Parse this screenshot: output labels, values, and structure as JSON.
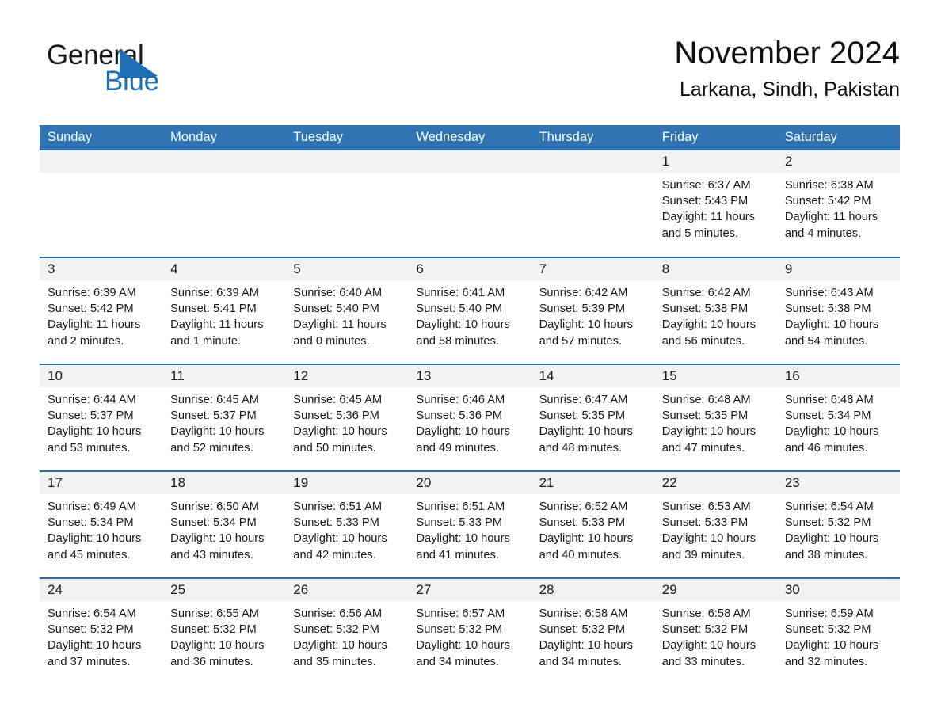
{
  "brand": {
    "name_part1": "General",
    "name_part2": "Blue",
    "accent_color": "#1f6fb5",
    "triangle_icon": "blue-triangle-icon"
  },
  "header": {
    "title": "November 2024",
    "subtitle": "Larkana, Sindh, Pakistan"
  },
  "colors": {
    "header_bar": "#3074b4",
    "row_divider": "#2e6da4",
    "date_strip": "#f2f2f2",
    "text": "#1a1a1a"
  },
  "weekday_headers": [
    "Sunday",
    "Monday",
    "Tuesday",
    "Wednesday",
    "Thursday",
    "Friday",
    "Saturday"
  ],
  "weeks": [
    [
      {
        "day": "",
        "empty": true
      },
      {
        "day": "",
        "empty": true
      },
      {
        "day": "",
        "empty": true
      },
      {
        "day": "",
        "empty": true
      },
      {
        "day": "",
        "empty": true
      },
      {
        "day": "1",
        "sunrise": "Sunrise: 6:37 AM",
        "sunset": "Sunset: 5:43 PM",
        "daylight1": "Daylight: 11 hours",
        "daylight2": "and 5 minutes."
      },
      {
        "day": "2",
        "sunrise": "Sunrise: 6:38 AM",
        "sunset": "Sunset: 5:42 PM",
        "daylight1": "Daylight: 11 hours",
        "daylight2": "and 4 minutes."
      }
    ],
    [
      {
        "day": "3",
        "sunrise": "Sunrise: 6:39 AM",
        "sunset": "Sunset: 5:42 PM",
        "daylight1": "Daylight: 11 hours",
        "daylight2": "and 2 minutes."
      },
      {
        "day": "4",
        "sunrise": "Sunrise: 6:39 AM",
        "sunset": "Sunset: 5:41 PM",
        "daylight1": "Daylight: 11 hours",
        "daylight2": "and 1 minute."
      },
      {
        "day": "5",
        "sunrise": "Sunrise: 6:40 AM",
        "sunset": "Sunset: 5:40 PM",
        "daylight1": "Daylight: 11 hours",
        "daylight2": "and 0 minutes."
      },
      {
        "day": "6",
        "sunrise": "Sunrise: 6:41 AM",
        "sunset": "Sunset: 5:40 PM",
        "daylight1": "Daylight: 10 hours",
        "daylight2": "and 58 minutes."
      },
      {
        "day": "7",
        "sunrise": "Sunrise: 6:42 AM",
        "sunset": "Sunset: 5:39 PM",
        "daylight1": "Daylight: 10 hours",
        "daylight2": "and 57 minutes."
      },
      {
        "day": "8",
        "sunrise": "Sunrise: 6:42 AM",
        "sunset": "Sunset: 5:38 PM",
        "daylight1": "Daylight: 10 hours",
        "daylight2": "and 56 minutes."
      },
      {
        "day": "9",
        "sunrise": "Sunrise: 6:43 AM",
        "sunset": "Sunset: 5:38 PM",
        "daylight1": "Daylight: 10 hours",
        "daylight2": "and 54 minutes."
      }
    ],
    [
      {
        "day": "10",
        "sunrise": "Sunrise: 6:44 AM",
        "sunset": "Sunset: 5:37 PM",
        "daylight1": "Daylight: 10 hours",
        "daylight2": "and 53 minutes."
      },
      {
        "day": "11",
        "sunrise": "Sunrise: 6:45 AM",
        "sunset": "Sunset: 5:37 PM",
        "daylight1": "Daylight: 10 hours",
        "daylight2": "and 52 minutes."
      },
      {
        "day": "12",
        "sunrise": "Sunrise: 6:45 AM",
        "sunset": "Sunset: 5:36 PM",
        "daylight1": "Daylight: 10 hours",
        "daylight2": "and 50 minutes."
      },
      {
        "day": "13",
        "sunrise": "Sunrise: 6:46 AM",
        "sunset": "Sunset: 5:36 PM",
        "daylight1": "Daylight: 10 hours",
        "daylight2": "and 49 minutes."
      },
      {
        "day": "14",
        "sunrise": "Sunrise: 6:47 AM",
        "sunset": "Sunset: 5:35 PM",
        "daylight1": "Daylight: 10 hours",
        "daylight2": "and 48 minutes."
      },
      {
        "day": "15",
        "sunrise": "Sunrise: 6:48 AM",
        "sunset": "Sunset: 5:35 PM",
        "daylight1": "Daylight: 10 hours",
        "daylight2": "and 47 minutes."
      },
      {
        "day": "16",
        "sunrise": "Sunrise: 6:48 AM",
        "sunset": "Sunset: 5:34 PM",
        "daylight1": "Daylight: 10 hours",
        "daylight2": "and 46 minutes."
      }
    ],
    [
      {
        "day": "17",
        "sunrise": "Sunrise: 6:49 AM",
        "sunset": "Sunset: 5:34 PM",
        "daylight1": "Daylight: 10 hours",
        "daylight2": "and 45 minutes."
      },
      {
        "day": "18",
        "sunrise": "Sunrise: 6:50 AM",
        "sunset": "Sunset: 5:34 PM",
        "daylight1": "Daylight: 10 hours",
        "daylight2": "and 43 minutes."
      },
      {
        "day": "19",
        "sunrise": "Sunrise: 6:51 AM",
        "sunset": "Sunset: 5:33 PM",
        "daylight1": "Daylight: 10 hours",
        "daylight2": "and 42 minutes."
      },
      {
        "day": "20",
        "sunrise": "Sunrise: 6:51 AM",
        "sunset": "Sunset: 5:33 PM",
        "daylight1": "Daylight: 10 hours",
        "daylight2": "and 41 minutes."
      },
      {
        "day": "21",
        "sunrise": "Sunrise: 6:52 AM",
        "sunset": "Sunset: 5:33 PM",
        "daylight1": "Daylight: 10 hours",
        "daylight2": "and 40 minutes."
      },
      {
        "day": "22",
        "sunrise": "Sunrise: 6:53 AM",
        "sunset": "Sunset: 5:33 PM",
        "daylight1": "Daylight: 10 hours",
        "daylight2": "and 39 minutes."
      },
      {
        "day": "23",
        "sunrise": "Sunrise: 6:54 AM",
        "sunset": "Sunset: 5:32 PM",
        "daylight1": "Daylight: 10 hours",
        "daylight2": "and 38 minutes."
      }
    ],
    [
      {
        "day": "24",
        "sunrise": "Sunrise: 6:54 AM",
        "sunset": "Sunset: 5:32 PM",
        "daylight1": "Daylight: 10 hours",
        "daylight2": "and 37 minutes."
      },
      {
        "day": "25",
        "sunrise": "Sunrise: 6:55 AM",
        "sunset": "Sunset: 5:32 PM",
        "daylight1": "Daylight: 10 hours",
        "daylight2": "and 36 minutes."
      },
      {
        "day": "26",
        "sunrise": "Sunrise: 6:56 AM",
        "sunset": "Sunset: 5:32 PM",
        "daylight1": "Daylight: 10 hours",
        "daylight2": "and 35 minutes."
      },
      {
        "day": "27",
        "sunrise": "Sunrise: 6:57 AM",
        "sunset": "Sunset: 5:32 PM",
        "daylight1": "Daylight: 10 hours",
        "daylight2": "and 34 minutes."
      },
      {
        "day": "28",
        "sunrise": "Sunrise: 6:58 AM",
        "sunset": "Sunset: 5:32 PM",
        "daylight1": "Daylight: 10 hours",
        "daylight2": "and 34 minutes."
      },
      {
        "day": "29",
        "sunrise": "Sunrise: 6:58 AM",
        "sunset": "Sunset: 5:32 PM",
        "daylight1": "Daylight: 10 hours",
        "daylight2": "and 33 minutes."
      },
      {
        "day": "30",
        "sunrise": "Sunrise: 6:59 AM",
        "sunset": "Sunset: 5:32 PM",
        "daylight1": "Daylight: 10 hours",
        "daylight2": "and 32 minutes."
      }
    ]
  ]
}
